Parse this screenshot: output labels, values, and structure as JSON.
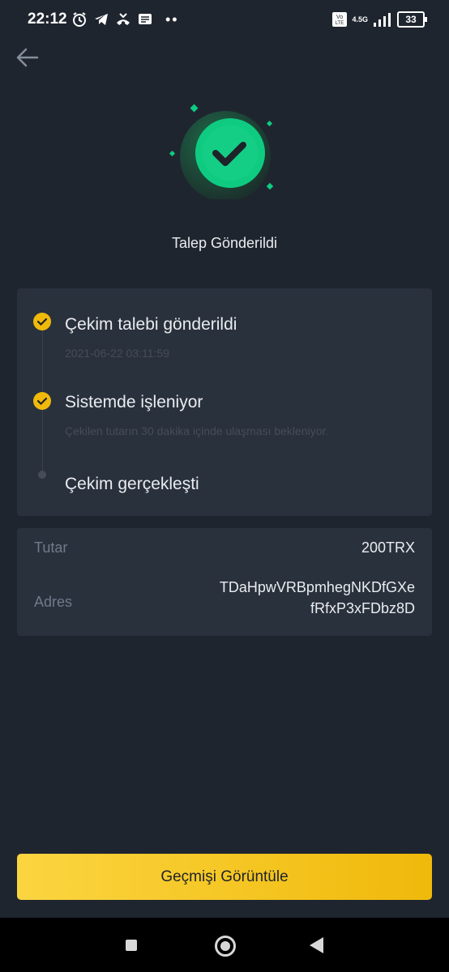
{
  "status_bar": {
    "time": "22:12",
    "network": "4.5G",
    "battery": "33",
    "overflow": "••"
  },
  "header": {
    "title": "Talep Gönderildi"
  },
  "steps": [
    {
      "title": "Çekim talebi gönderildi",
      "subtitle": "2021-06-22 03:11:59",
      "status": "done"
    },
    {
      "title": "Sistemde işleniyor",
      "subtitle": "Çekilen tutarın 30 dakika içinde ulaşması bekleniyor.",
      "status": "done"
    },
    {
      "title": "Çekim gerçekleşti",
      "subtitle": "",
      "status": "pending"
    }
  ],
  "details": {
    "amount_label": "Tutar",
    "amount_value": "200TRX",
    "address_label": "Adres",
    "address_line1": "TDaHpwVRBpmhegNKDfGXe",
    "address_line2": "fRfxP3xFDbz8D"
  },
  "actions": {
    "history_button": "Geçmişi Görüntüle"
  },
  "colors": {
    "background": "#1f252e",
    "card": "#29313d",
    "accent": "#f0b90b",
    "success": "#0ecb81"
  }
}
